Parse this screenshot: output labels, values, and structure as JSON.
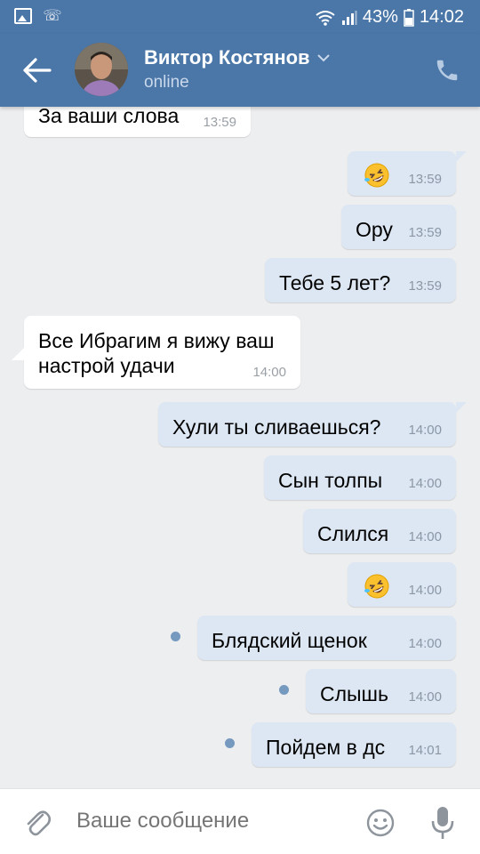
{
  "status_bar": {
    "battery": "43%",
    "time": "14:02"
  },
  "header": {
    "name": "Виктор Костянов",
    "status": "online"
  },
  "messages": [
    {
      "dir": "in",
      "text": "За ваши слова",
      "time": "13:59"
    },
    {
      "dir": "out",
      "emoji": "rolling-on-floor-laughing",
      "time": "13:59"
    },
    {
      "dir": "out",
      "text": "Ору",
      "time": "13:59"
    },
    {
      "dir": "out",
      "text": "Тебе 5 лет?",
      "time": "13:59"
    },
    {
      "dir": "in",
      "text": "Все Ибрагим я вижу ваш\nнастрой удачи",
      "time": "14:00"
    },
    {
      "dir": "out",
      "text": "Хули ты сливаешься?",
      "time": "14:00"
    },
    {
      "dir": "out",
      "text": "Сын толпы",
      "time": "14:00"
    },
    {
      "dir": "out",
      "text": "Слился",
      "time": "14:00"
    },
    {
      "dir": "out",
      "emoji": "rolling-on-floor-laughing",
      "time": "14:00"
    },
    {
      "dir": "out",
      "text": "Блядский щенок",
      "time": "14:00",
      "unread": true
    },
    {
      "dir": "out",
      "text": "Слышь",
      "time": "14:00",
      "unread": true
    },
    {
      "dir": "out",
      "text": "Пойдем в дс",
      "time": "14:01",
      "unread": true
    }
  ],
  "composer": {
    "placeholder": "Ваше сообщение"
  },
  "colors": {
    "header": "#4a76a8",
    "background": "#edeef0",
    "outgoing_bubble": "#dde7f3",
    "incoming_bubble": "#ffffff",
    "unread_dot": "#7699c0"
  },
  "icons": [
    "gallery-icon",
    "missed-call-icon",
    "wifi-icon",
    "signal-icon",
    "battery-icon",
    "back-arrow-icon",
    "chevron-down-icon",
    "phone-icon",
    "paperclip-icon",
    "smile-icon",
    "microphone-icon"
  ]
}
